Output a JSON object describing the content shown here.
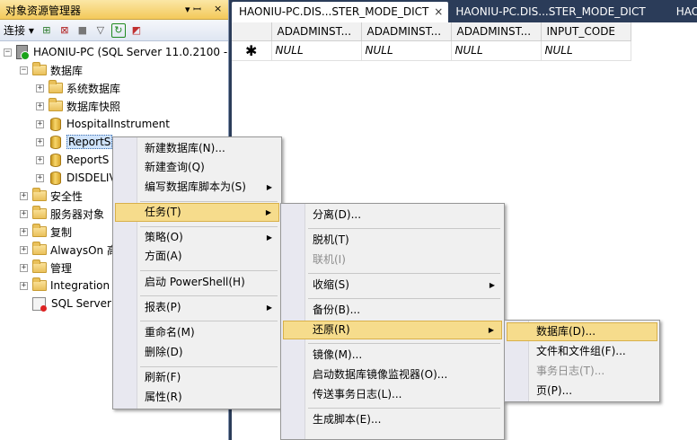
{
  "explorer": {
    "title": "对象资源管理器",
    "title_pin": "▾ ꟷ",
    "title_close": "×",
    "toolbar": {
      "connect_label": "连接 ▾"
    }
  },
  "tree": {
    "server": "HAONIU-PC (SQL Server 11.0.2100 -",
    "databases_folder": "数据库",
    "system_databases": "系统数据库",
    "snapshots": "数据库快照",
    "db_hospital": "HospitalInstrument",
    "db_report1": "ReportS",
    "db_report2": "ReportS",
    "db_disdeliv": "DISDELIV",
    "security": "安全性",
    "server_objects": "服务器对象",
    "replication": "复制",
    "alwayson": "AlwaysOn 高",
    "management": "管理",
    "integration": "Integration",
    "agent": "SQL Server"
  },
  "tabs": [
    {
      "label": "HAONIU-PC.DIS...STER_MODE_DICT",
      "close": "×"
    },
    {
      "label": "HAONIU-PC.DIS...STER_MODE_DICT"
    },
    {
      "label": "HAO"
    }
  ],
  "grid": {
    "columns": [
      "ADADMINST...",
      "ADADMINST...",
      "ADADMINST...",
      "INPUT_CODE"
    ],
    "new_row_marker": "✱",
    "new_row_values": [
      "NULL",
      "NULL",
      "NULL",
      "NULL"
    ]
  },
  "menu1": {
    "new_database": "新建数据库(N)...",
    "new_query": "新建查询(Q)",
    "script_as": "编写数据库脚本为(S)",
    "tasks": "任务(T)",
    "policies": "策略(O)",
    "facets": "方面(A)",
    "powershell": "启动 PowerShell(H)",
    "reports": "报表(P)",
    "rename": "重命名(M)",
    "delete": "删除(D)",
    "refresh": "刷新(F)",
    "properties": "属性(R)"
  },
  "menu2": {
    "detach": "分离(D)...",
    "take_offline": "脱机(T)",
    "bring_online": "联机(I)",
    "shrink": "收缩(S)",
    "backup": "备份(B)...",
    "restore": "还原(R)",
    "mirror": "镜像(M)...",
    "mirror_monitor": "启动数据库镜像监视器(O)...",
    "log_shipping": "传送事务日志(L)...",
    "generate_scripts": "生成脚本(E)..."
  },
  "menu3": {
    "database": "数据库(D)...",
    "files_filegroups": "文件和文件组(F)...",
    "transaction_log": "事务日志(T)...",
    "page": "页(P)..."
  },
  "submenu_arrow": "▶"
}
